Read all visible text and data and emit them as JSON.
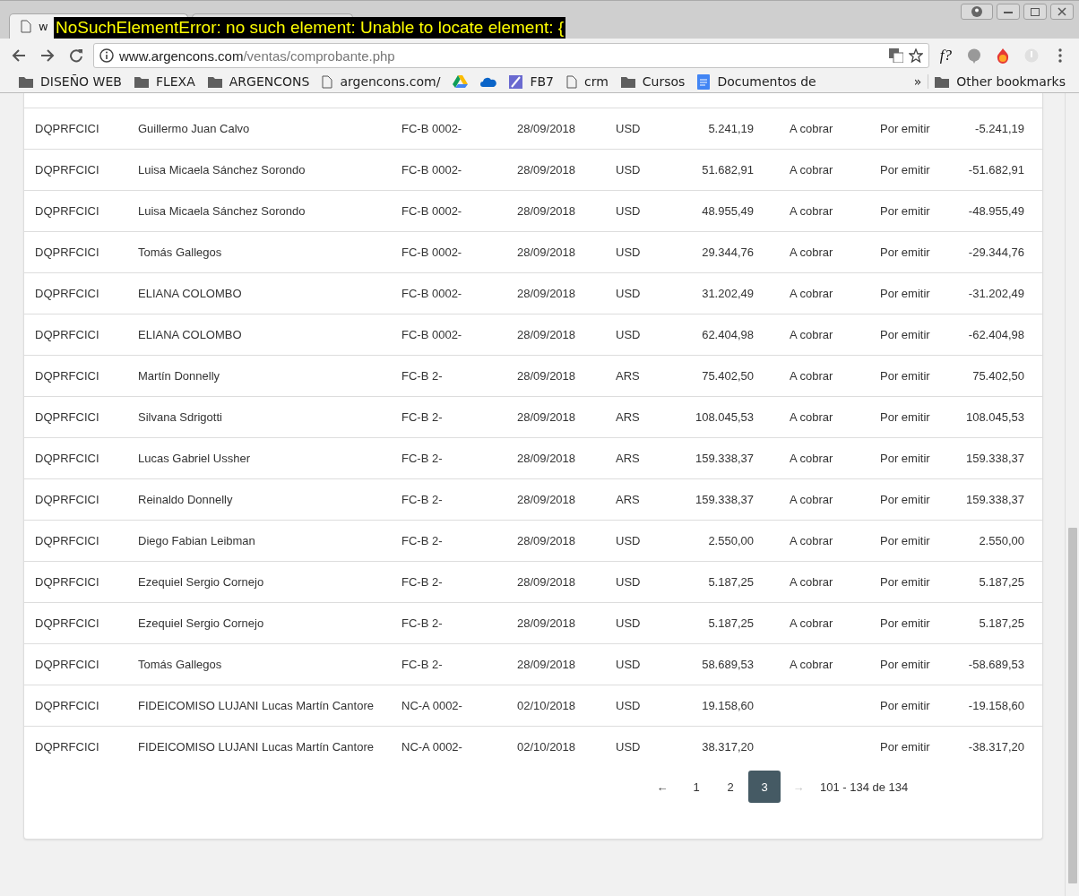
{
  "browser": {
    "tabs": [
      {
        "title": "w",
        "selected": true
      },
      {
        "selected": false
      }
    ],
    "overlay_message": "NoSuchElementError: no such element: Unable to locate element: {",
    "address": {
      "host": "www.argencons.com",
      "path": "/ventas/comprobante.php"
    },
    "extension_label": "f?",
    "bookmarks": [
      {
        "kind": "folder",
        "label": "DISEÑO WEB"
      },
      {
        "kind": "folder",
        "label": "FLEXA"
      },
      {
        "kind": "folder",
        "label": "ARGENCONS"
      },
      {
        "kind": "page",
        "label": "argencons.com/"
      },
      {
        "kind": "drive"
      },
      {
        "kind": "cloud"
      },
      {
        "kind": "app",
        "label": "FB7"
      },
      {
        "kind": "page",
        "label": "crm"
      },
      {
        "kind": "folder",
        "label": "Cursos"
      },
      {
        "kind": "doc",
        "label": "Documentos de"
      }
    ],
    "overflow_label": "»",
    "other_bookmarks": "Other bookmarks"
  },
  "table": {
    "rows": [
      [
        "DQPRFCICI",
        "Guillermo Juan Calvo",
        "FC-B 0002-",
        "28/09/2018",
        "USD",
        "5.241,19",
        "A cobrar",
        "Por emitir",
        "-5.241,19"
      ],
      [
        "DQPRFCICI",
        "Luisa Micaela Sánchez Sorondo",
        "FC-B 0002-",
        "28/09/2018",
        "USD",
        "51.682,91",
        "A cobrar",
        "Por emitir",
        "-51.682,91"
      ],
      [
        "DQPRFCICI",
        "Luisa Micaela Sánchez Sorondo",
        "FC-B 0002-",
        "28/09/2018",
        "USD",
        "48.955,49",
        "A cobrar",
        "Por emitir",
        "-48.955,49"
      ],
      [
        "DQPRFCICI",
        "Tomás Gallegos",
        "FC-B 0002-",
        "28/09/2018",
        "USD",
        "29.344,76",
        "A cobrar",
        "Por emitir",
        "-29.344,76"
      ],
      [
        "DQPRFCICI",
        "ELIANA COLOMBO",
        "FC-B 0002-",
        "28/09/2018",
        "USD",
        "31.202,49",
        "A cobrar",
        "Por emitir",
        "-31.202,49"
      ],
      [
        "DQPRFCICI",
        "ELIANA COLOMBO",
        "FC-B 0002-",
        "28/09/2018",
        "USD",
        "62.404,98",
        "A cobrar",
        "Por emitir",
        "-62.404,98"
      ],
      [
        "DQPRFCICI",
        "Martín Donnelly",
        "FC-B 2-",
        "28/09/2018",
        "ARS",
        "75.402,50",
        "A cobrar",
        "Por emitir",
        "75.402,50"
      ],
      [
        "DQPRFCICI",
        "Silvana Sdrigotti",
        "FC-B 2-",
        "28/09/2018",
        "ARS",
        "108.045,53",
        "A cobrar",
        "Por emitir",
        "108.045,53"
      ],
      [
        "DQPRFCICI",
        "Lucas Gabriel  Ussher",
        "FC-B 2-",
        "28/09/2018",
        "ARS",
        "159.338,37",
        "A cobrar",
        "Por emitir",
        "159.338,37"
      ],
      [
        "DQPRFCICI",
        "Reinaldo  Donnelly",
        "FC-B 2-",
        "28/09/2018",
        "ARS",
        "159.338,37",
        "A cobrar",
        "Por emitir",
        "159.338,37"
      ],
      [
        "DQPRFCICI",
        "Diego Fabian Leibman",
        "FC-B 2-",
        "28/09/2018",
        "USD",
        "2.550,00",
        "A cobrar",
        "Por emitir",
        "2.550,00"
      ],
      [
        "DQPRFCICI",
        "Ezequiel Sergio Cornejo",
        "FC-B 2-",
        "28/09/2018",
        "USD",
        "5.187,25",
        "A cobrar",
        "Por emitir",
        "5.187,25"
      ],
      [
        "DQPRFCICI",
        "Ezequiel Sergio Cornejo",
        "FC-B 2-",
        "28/09/2018",
        "USD",
        "5.187,25",
        "A cobrar",
        "Por emitir",
        "5.187,25"
      ],
      [
        "DQPRFCICI",
        "Tomás Gallegos",
        "FC-B 2-",
        "28/09/2018",
        "USD",
        "58.689,53",
        "A cobrar",
        "Por emitir",
        "-58.689,53"
      ],
      [
        "DQPRFCICI",
        "FIDEICOMISO LUJANI Lucas Martín  Cantore",
        "NC-A 0002-",
        "02/10/2018",
        "USD",
        "19.158,60",
        null,
        "Por emitir",
        "-19.158,60"
      ],
      [
        "DQPRFCICI",
        "FIDEICOMISO LUJANI Lucas Martín  Cantore",
        "NC-A 0002-",
        "02/10/2018",
        "USD",
        "38.317,20",
        null,
        "Por emitir",
        "-38.317,20"
      ]
    ]
  },
  "pagination": {
    "prev": {
      "label": "←",
      "disabled": false
    },
    "pages": [
      {
        "label": "1",
        "selected": false
      },
      {
        "label": "2",
        "selected": false
      },
      {
        "label": "3",
        "selected": true
      }
    ],
    "next": {
      "label": "→",
      "disabled": true
    },
    "summary": "101 - 134 de 134"
  }
}
